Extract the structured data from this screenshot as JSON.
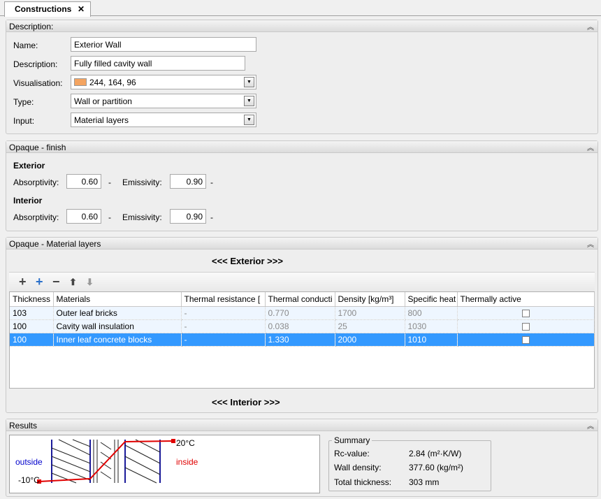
{
  "tab": {
    "title": "Constructions",
    "close": "✕"
  },
  "description_section": {
    "title": "Description:",
    "name_label": "Name:",
    "name_value": "Exterior Wall",
    "description_label": "Description:",
    "description_value": "Fully filled cavity wall",
    "visualisation_label": "Visualisation:",
    "visualisation_value": "244, 164, 96",
    "visualisation_color": "#F4A460",
    "type_label": "Type:",
    "type_value": "Wall or partition",
    "input_label": "Input:",
    "input_value": "Material layers"
  },
  "finish_section": {
    "title": "Opaque - finish",
    "exterior_heading": "Exterior",
    "interior_heading": "Interior",
    "absorptivity_label": "Absorptivity:",
    "emissivity_label": "Emissivity:",
    "dash": "-",
    "exterior_absorptivity": "0.60",
    "exterior_emissivity": "0.90",
    "interior_absorptivity": "0.60",
    "interior_emissivity": "0.90"
  },
  "layers_section": {
    "title": "Opaque - Material layers",
    "exterior_banner": "<<< Exterior >>>",
    "interior_banner": "<<< Interior >>>",
    "columns": [
      "Thickness",
      "Materials",
      "Thermal resistance [",
      "Thermal conducti",
      "Density [kg/m³]",
      "Specific heat",
      "Thermally active"
    ],
    "rows": [
      {
        "thickness": "103",
        "material": "Outer leaf bricks",
        "resistance": "-",
        "conductivity": "0.770",
        "density": "1700",
        "specific_heat": "800",
        "selected": false
      },
      {
        "thickness": "100",
        "material": "Cavity wall insulation",
        "resistance": "-",
        "conductivity": "0.038",
        "density": "25",
        "specific_heat": "1030",
        "selected": false
      },
      {
        "thickness": "100",
        "material": "Inner leaf concrete blocks",
        "resistance": "-",
        "conductivity": "1.330",
        "density": "2000",
        "specific_heat": "1010",
        "selected": true
      }
    ]
  },
  "results_section": {
    "title": "Results",
    "outside_label": "outside",
    "inside_label": "inside",
    "temp_inside": "20°C",
    "temp_outside": "-10°C",
    "summary_title": "Summary",
    "rc_label": "Rc-value:",
    "rc_value": "2.84 (m²·K/W)",
    "density_label": "Wall density:",
    "density_value": "377.60 (kg/m²)",
    "thickness_label": "Total thickness:",
    "thickness_value": "303 mm"
  },
  "colors": {
    "selection": "#3399ff",
    "outside_text": "#0000cc",
    "inside_text": "#e00000",
    "temp_line": "#e00000"
  }
}
